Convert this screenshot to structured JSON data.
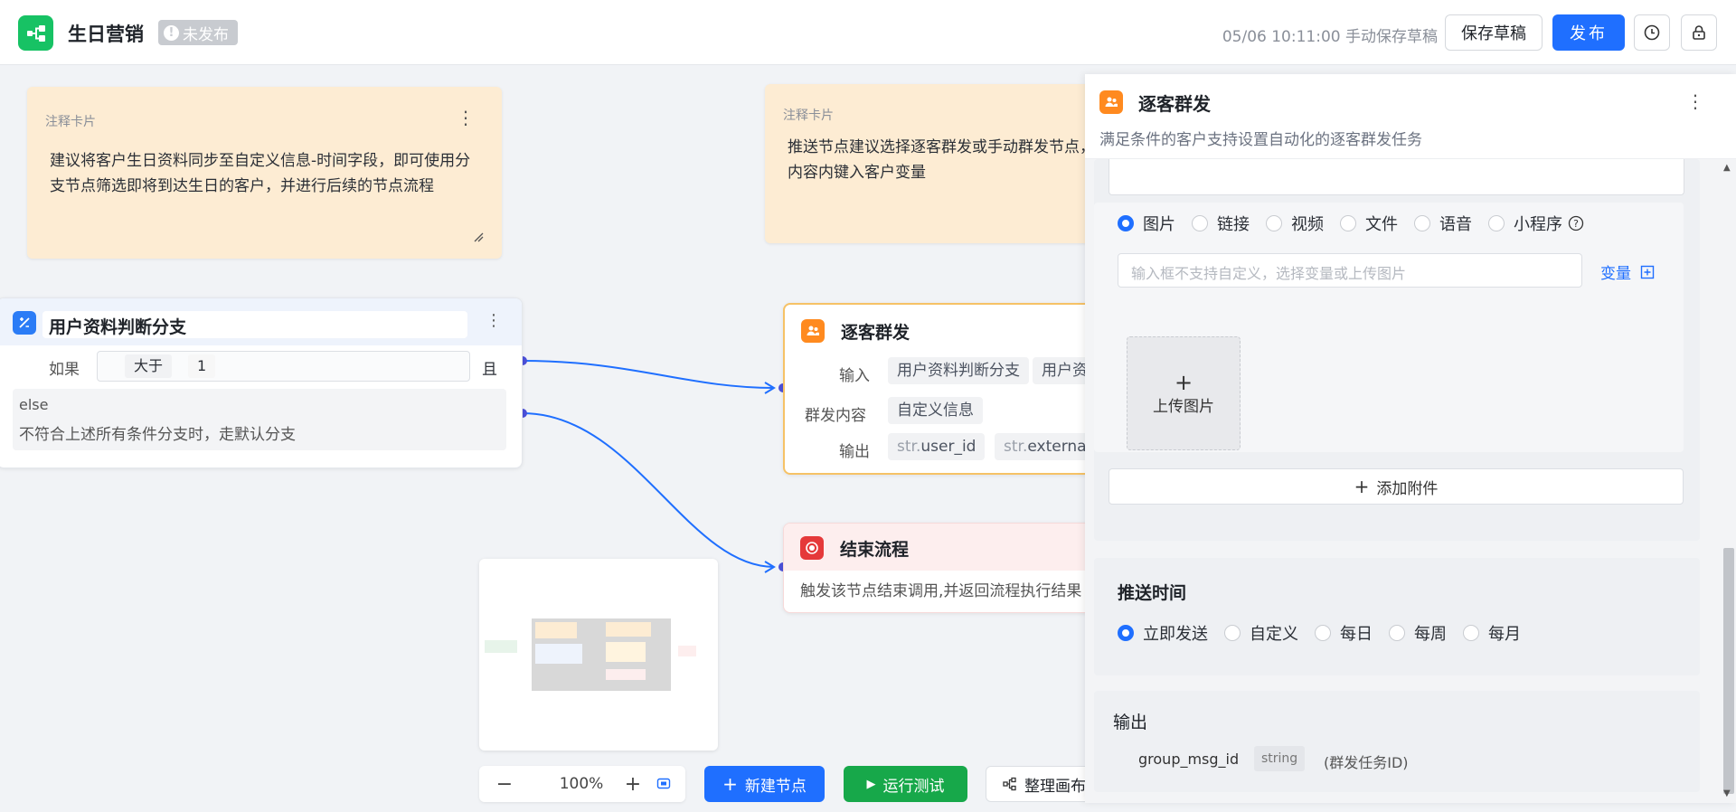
{
  "header": {
    "app_title": "生日营销",
    "status": "未发布",
    "status_mark": "!",
    "save_time": "05/06 10:11:00 手动保存草稿",
    "save_draft_label": "保存草稿",
    "publish_label": "发布"
  },
  "notes": [
    {
      "title": "注释卡片",
      "text": "建议将客户生日资料同步至自定义信息-时间字段，即可使用分支节点筛选即将到达生日的客户，并进行后续的节点流程"
    },
    {
      "title": "注释卡片",
      "text": "推送节点建议选择逐客群发或手动群发节点，内容内键入客户变量"
    }
  ],
  "branch_node": {
    "title": "用户资料判断分支",
    "if_label": "如果",
    "operator": "大于",
    "value": "1",
    "and_label": "且",
    "else_title": "else",
    "else_desc": "不符合上述所有条件分支时，走默认分支"
  },
  "qk_node": {
    "title": "逐客群发",
    "input_label": "输入",
    "input_tag1": "用户资料判断分支",
    "input_tag2": "用户资",
    "content_label": "群发内容",
    "content_tag": "自定义信息",
    "output_label": "输出",
    "out1_prefix": "str.",
    "out1_name": "user_id",
    "out2_prefix": "str.",
    "out2_name": "external_"
  },
  "end_node": {
    "title": "结束流程",
    "desc": "触发该节点结束调用,并返回流程执行结果"
  },
  "toolbar": {
    "zoom": "100%",
    "new_node": "新建节点",
    "run_test": "运行测试",
    "tidy_canvas": "整理画布"
  },
  "panel": {
    "title": "逐客群发",
    "desc": "满足条件的客户支持设置自动化的逐客群发任务",
    "attach_types": [
      "图片",
      "链接",
      "视频",
      "文件",
      "语音",
      "小程序"
    ],
    "attach_placeholder": "输入框不支持自定义，选择变量或上传图片",
    "variable_label": "变量",
    "upload_label": "上传图片",
    "add_attachment": "添加附件",
    "push_time_title": "推送时间",
    "push_options": [
      "立即发送",
      "自定义",
      "每日",
      "每周",
      "每月"
    ],
    "output_title": "输出",
    "output_field": "group_msg_id",
    "output_type": "string",
    "output_desc": "(群发任务ID)"
  },
  "colors": {
    "primary": "#1f6fff",
    "success": "#17a84a",
    "brand": "#17c264",
    "note_bg": "#fdecd3",
    "qk_border": "#f6c266",
    "end_red": "#e5393a"
  }
}
